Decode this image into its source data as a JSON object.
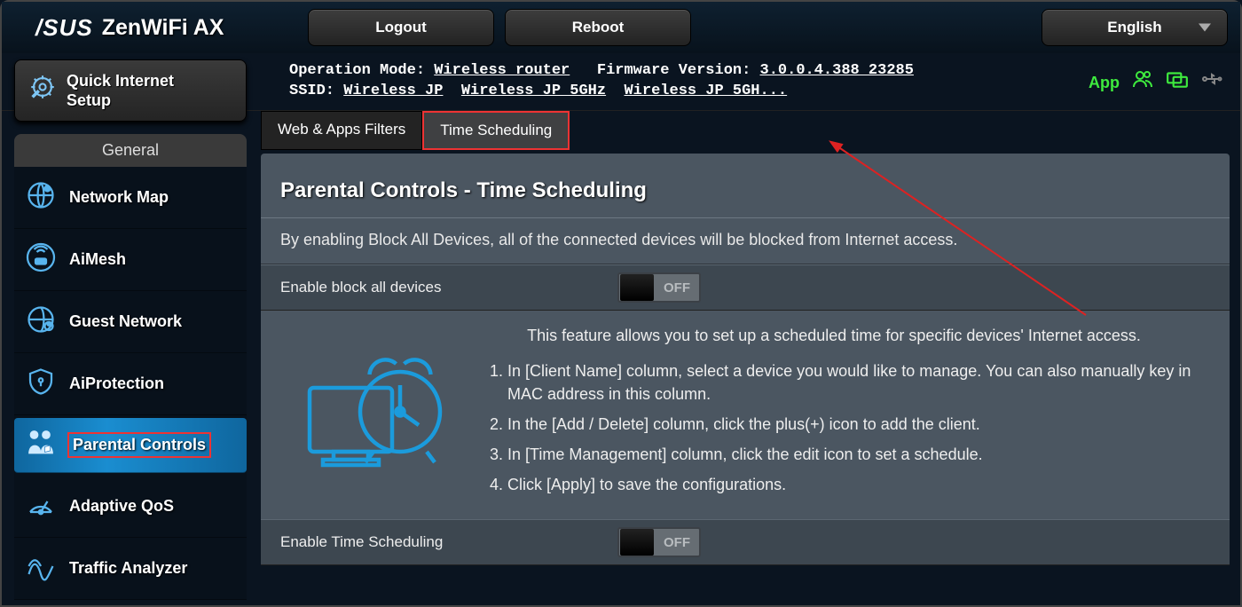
{
  "brand": "/SUS",
  "product": "ZenWiFi AX",
  "header": {
    "logout": "Logout",
    "reboot": "Reboot",
    "language": "English"
  },
  "info": {
    "op_mode_label": "Operation Mode:",
    "op_mode_value": "Wireless router",
    "fw_label": "Firmware Version:",
    "fw_value": "3.0.0.4.388_23285",
    "ssid_label": "SSID:",
    "ssid1": "Wireless JP",
    "ssid2": "Wireless JP 5GHz",
    "ssid3": "Wireless JP 5GH...",
    "app_link": "App"
  },
  "sidebar": {
    "quick_setup_l1": "Quick Internet",
    "quick_setup_l2": "Setup",
    "section": "General",
    "items": [
      {
        "label": "Network Map"
      },
      {
        "label": "AiMesh"
      },
      {
        "label": "Guest Network"
      },
      {
        "label": "AiProtection"
      },
      {
        "label": "Parental Controls",
        "active": true
      },
      {
        "label": "Adaptive QoS"
      },
      {
        "label": "Traffic Analyzer"
      }
    ]
  },
  "tabs": {
    "filters": "Web & Apps Filters",
    "schedule": "Time Scheduling"
  },
  "panel": {
    "title": "Parental Controls - Time Scheduling",
    "desc": "By enabling Block All Devices, all of the connected devices will be blocked from Internet access.",
    "row1_label": "Enable block all devices",
    "row1_toggle": "OFF",
    "feature_intro": "This feature allows you to set up a scheduled time for specific devices' Internet access.",
    "steps": [
      "In [Client Name] column, select a device you would like to manage. You can also manually key in MAC address in this column.",
      "In the [Add / Delete] column, click the plus(+) icon to add the client.",
      "In [Time Management] column, click the edit icon to set a schedule.",
      "Click [Apply] to save the configurations."
    ],
    "row2_label": "Enable Time Scheduling",
    "row2_toggle": "OFF"
  }
}
